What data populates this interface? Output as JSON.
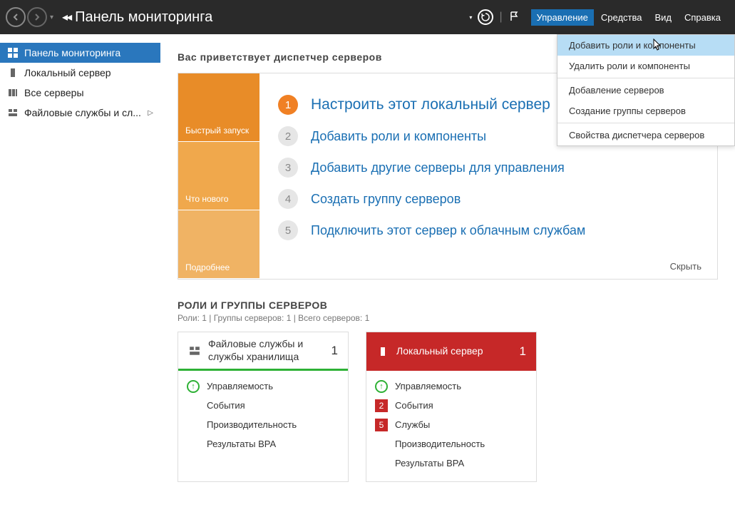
{
  "header": {
    "title": "Панель мониторинга",
    "menu": {
      "manage": "Управление",
      "tools": "Средства",
      "view": "Вид",
      "help": "Справка"
    },
    "dropdown": [
      "Добавить роли и компоненты",
      "Удалить роли и компоненты",
      "Добавление серверов",
      "Создание группы серверов",
      "Свойства диспетчера серверов"
    ]
  },
  "sidebar": {
    "items": [
      "Панель мониторинга",
      "Локальный сервер",
      "Все серверы",
      "Файловые службы и сл..."
    ]
  },
  "content": {
    "welcome_heading": "Вас приветствует диспетчер серверов",
    "tiles": {
      "quick": "Быстрый запуск",
      "new": "Что нового",
      "more": "Подробнее"
    },
    "steps": [
      "Настроить этот локальный сервер",
      "Добавить роли и компоненты",
      "Добавить другие серверы для управления",
      "Создать группу серверов",
      "Подключить этот сервер к облачным службам"
    ],
    "hide": "Скрыть",
    "roles_heading": "РОЛИ И ГРУППЫ СЕРВЕРОВ",
    "roles_sub": "Роли: 1 | Группы серверов: 1 | Всего серверов: 1",
    "card1": {
      "title": "Файловые службы и службы хранилища",
      "count": "1",
      "rows": [
        "Управляемость",
        "События",
        "Производительность",
        "Результаты BPA"
      ]
    },
    "card2": {
      "title": "Локальный сервер",
      "count": "1",
      "rows": [
        "Управляемость",
        "События",
        "Службы",
        "Производительность",
        "Результаты BPA"
      ],
      "badges": {
        "events": "2",
        "services": "5"
      }
    }
  }
}
